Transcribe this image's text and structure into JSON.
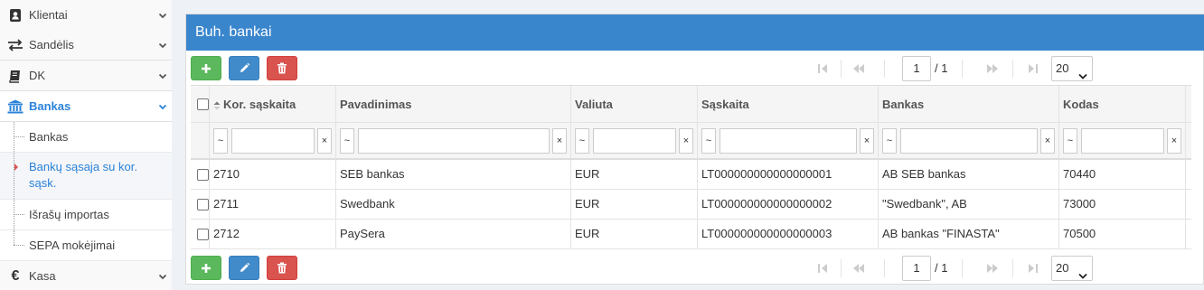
{
  "sidebar": {
    "items": [
      {
        "label": "Klientai",
        "icon": "address-book-icon"
      },
      {
        "label": "Sandėlis",
        "icon": "exchange-arrows-icon"
      },
      {
        "label": "DK",
        "icon": "book-icon"
      },
      {
        "label": "Bankas",
        "icon": "bank-building-icon"
      },
      {
        "label": "Kasa",
        "icon": "euro-icon"
      }
    ],
    "bankas_sub": [
      {
        "label": "Bankas"
      },
      {
        "label": "Bankų sąsaja su kor. sąsk."
      },
      {
        "label": "Išrašų importas"
      },
      {
        "label": "SEPA mokėjimai"
      }
    ]
  },
  "panel": {
    "title": "Buh. bankai"
  },
  "toolbar": {
    "add_icon": "plus-icon",
    "edit_icon": "pencil-icon",
    "delete_icon": "trash-icon"
  },
  "pager": {
    "current_page": "1",
    "total_pages": "/ 1",
    "page_size": "20"
  },
  "grid": {
    "columns": [
      "Kor. sąskaita",
      "Pavadinimas",
      "Valiuta",
      "Sąskaita",
      "Bankas",
      "Kodas"
    ],
    "filter_op": "~",
    "filter_clear": "×",
    "rows": [
      [
        "2710",
        "SEB bankas",
        "EUR",
        "LT000000000000000001",
        "AB SEB bankas",
        "70440"
      ],
      [
        "2711",
        "Swedbank",
        "EUR",
        "LT000000000000000002",
        "\"Swedbank\", AB",
        "73000"
      ],
      [
        "2712",
        "PaySera",
        "EUR",
        "LT000000000000000003",
        "AB bankas \"FINASTA\"",
        "70500"
      ]
    ]
  },
  "colors": {
    "header_blue": "#3a86cd",
    "active_link": "#2b82d9",
    "add_green": "#5cb85c",
    "edit_blue": "#428bca",
    "delete_red": "#d9534f"
  }
}
